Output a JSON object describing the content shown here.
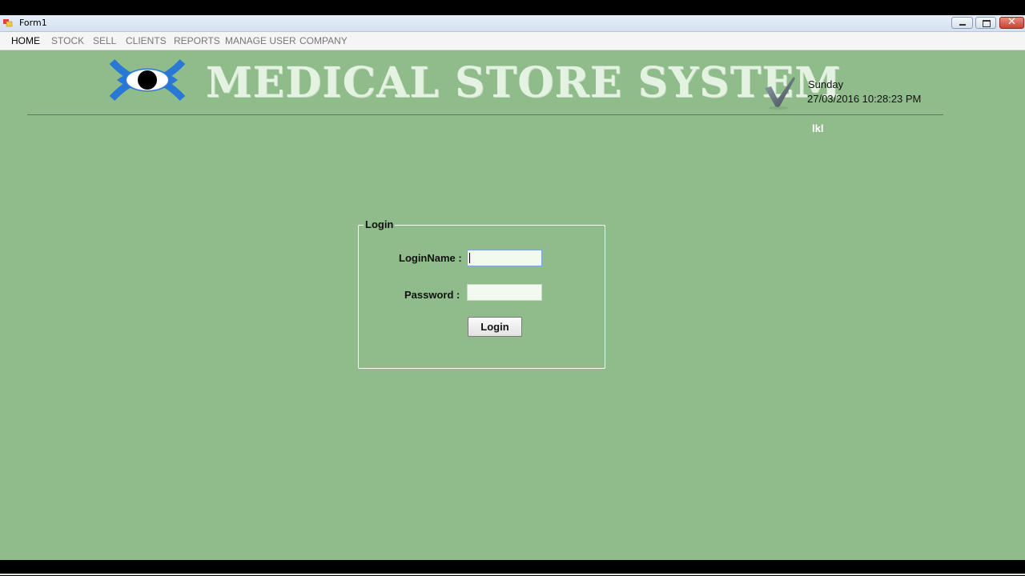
{
  "window": {
    "title": "Form1",
    "controls": {
      "minimize": "minimize",
      "maximize": "restore",
      "close": "✕"
    }
  },
  "menu": {
    "items": [
      {
        "label": "HOME",
        "active": true
      },
      {
        "label": "STOCK",
        "active": false
      },
      {
        "label": "SELL",
        "active": false
      },
      {
        "label": "CLIENTS",
        "active": false
      },
      {
        "label": "REPORTS",
        "active": false
      },
      {
        "label": "MANAGE USER",
        "active": false
      },
      {
        "label": "COMPANY",
        "active": false
      }
    ]
  },
  "header": {
    "logo_icon": "eye-logo-icon",
    "title": "MEDICAL STORE SYSTEM",
    "check_icon": "checkmark-logo-icon",
    "day": "Sunday",
    "datetime": "27/03/2016 10:28:23 PM",
    "user": "lkl"
  },
  "login": {
    "group_title": "Login",
    "login_name_label": "LoginName :",
    "login_name_value": "",
    "password_label": "Password :",
    "password_value": "",
    "button_label": "Login"
  },
  "colors": {
    "background": "#8fbc8a",
    "logo_blue": "#2a78d6",
    "title_text": "#e4f3e1"
  }
}
